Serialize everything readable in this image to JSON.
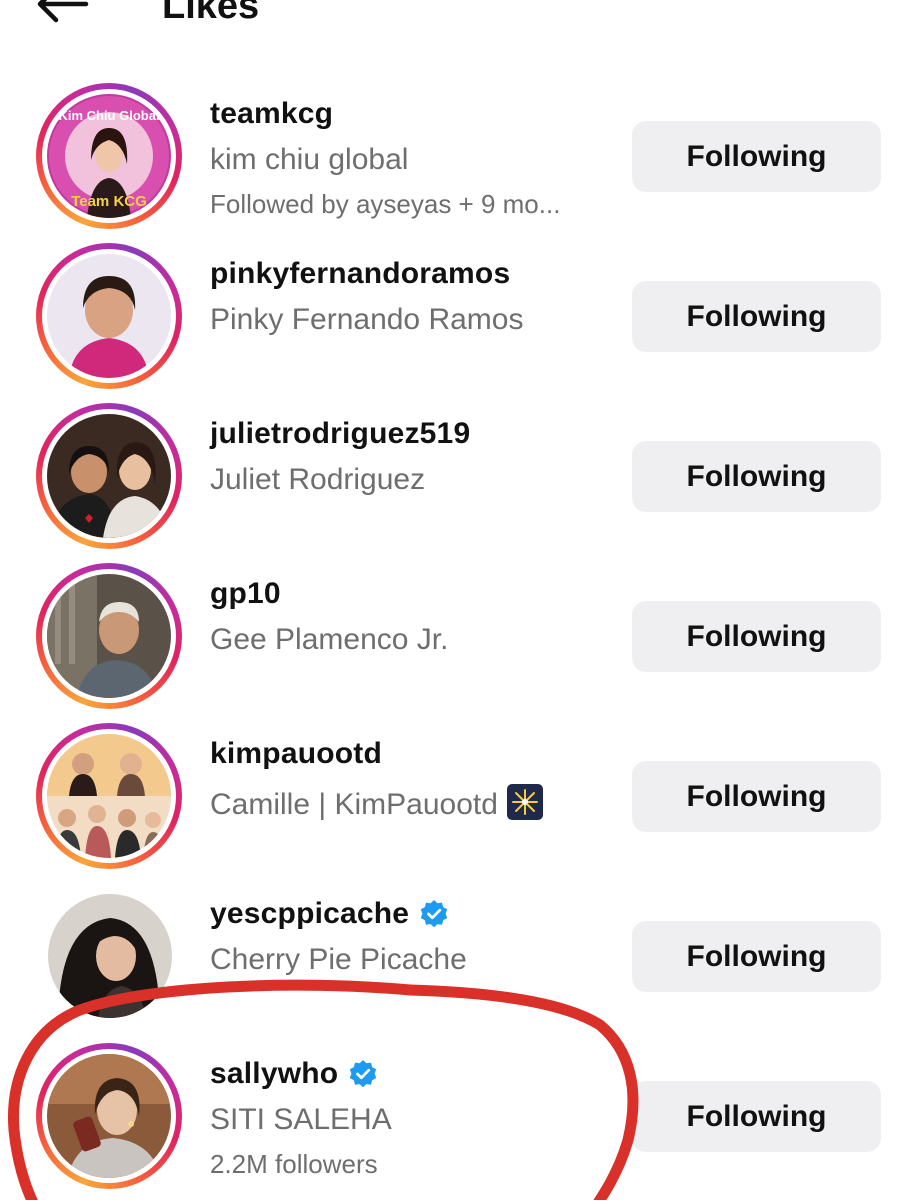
{
  "header": {
    "title": "Likes",
    "back_icon": "arrow-left-icon"
  },
  "colors": {
    "story_ring_start": "#f9a53b",
    "story_ring_end": "#c52c9e",
    "verified_badge": "#1d9bf0",
    "button_bg": "#efeff1",
    "secondary_text": "#6e6e6e",
    "highlight_circle": "#d9302a"
  },
  "users": [
    {
      "username": "teamkcg",
      "full_name": "kim chiu global",
      "subline": "Followed by ayseyas + 9 mo...",
      "button_label": "Following",
      "verified": false,
      "story_ring": true
    },
    {
      "username": "pinkyfernandoramos",
      "full_name": "Pinky Fernando Ramos",
      "button_label": "Following",
      "verified": false,
      "story_ring": true
    },
    {
      "username": "julietrodriguez519",
      "full_name": "Juliet Rodriguez",
      "button_label": "Following",
      "verified": false,
      "story_ring": true
    },
    {
      "username": "gp10",
      "full_name": "Gee Plamenco Jr.",
      "button_label": "Following",
      "verified": false,
      "story_ring": true
    },
    {
      "username": "kimpauootd",
      "full_name": "Camille | KimPauootd",
      "name_emoji": "fireworks-emoji-icon",
      "button_label": "Following",
      "verified": false,
      "story_ring": true
    },
    {
      "username": "yescppicache",
      "full_name": "Cherry Pie Picache",
      "button_label": "Following",
      "verified": true,
      "story_ring": false
    },
    {
      "username": "sallywho",
      "full_name": "SITI SALEHA",
      "subline": "2.2M followers",
      "button_label": "Following",
      "verified": true,
      "story_ring": true,
      "highlighted": true
    }
  ]
}
